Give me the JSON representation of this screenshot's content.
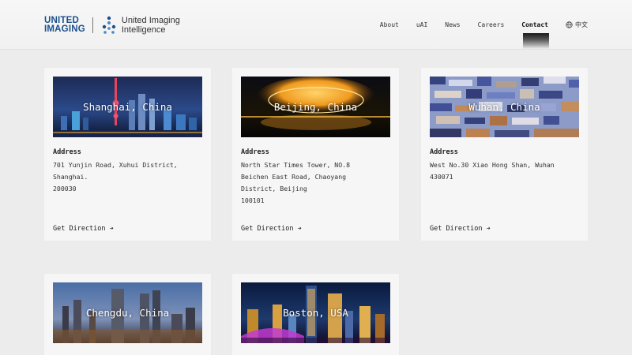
{
  "header": {
    "logo_united": "UNITED",
    "logo_imaging": "IMAGING",
    "logo_uii_line1": "United Imaging",
    "logo_uii_line2": "Intelligence",
    "nav": [
      "About",
      "uAI",
      "News",
      "Careers",
      "Contact"
    ],
    "active_nav": "Contact",
    "language": "中文"
  },
  "locations": [
    {
      "city": "Shanghai, China",
      "address_label": "Address",
      "address": "701 Yunjin Road, Xuhui District,\nShanghai.\n200030",
      "direction": "Get Direction ➔"
    },
    {
      "city": "Beijing, China",
      "address_label": "Address",
      "address": "North Star Times Tower, NO.8\nBeichen East Road, Chaoyang\nDistrict, Beijing\n100101",
      "direction": "Get Direction ➔"
    },
    {
      "city": "Wuhan, China",
      "address_label": "Address",
      "address": "West No.30 Xiao Hong Shan, Wuhan\n430071",
      "direction": "Get Direction ➔"
    },
    {
      "city": "Chengdu, China"
    },
    {
      "city": "Boston, USA"
    }
  ],
  "colors": {
    "brand_blue": "#1b4f8c",
    "background": "#ececec",
    "card": "#f6f6f6"
  }
}
